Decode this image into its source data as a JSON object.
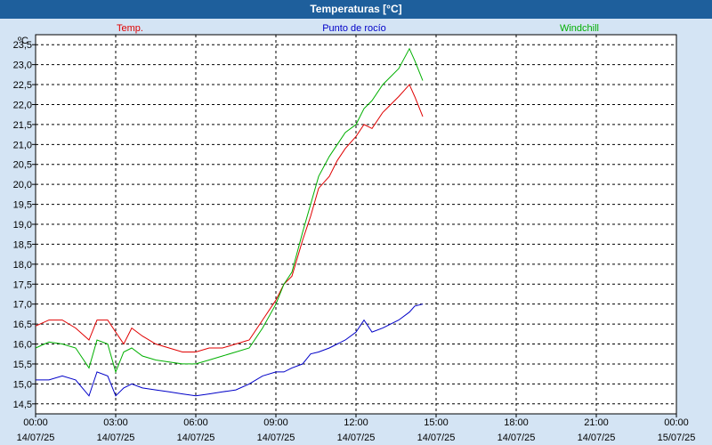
{
  "window": {
    "title": "Temperaturas [°C]"
  },
  "chart_data": {
    "type": "line",
    "title": "Temperaturas [°C]",
    "y_unit": "ºC",
    "ylim": [
      14.25,
      23.75
    ],
    "y_ticks": [
      "14,5",
      "15,0",
      "15,5",
      "16,0",
      "16,5",
      "17,0",
      "17,5",
      "18,0",
      "18,5",
      "19,0",
      "19,5",
      "20,0",
      "20,5",
      "21,0",
      "21,5",
      "22,0",
      "22,5",
      "23,0",
      "23,5"
    ],
    "y_tick_values": [
      14.5,
      15.0,
      15.5,
      16.0,
      16.5,
      17.0,
      17.5,
      18.0,
      18.5,
      19.0,
      19.5,
      20.0,
      20.5,
      21.0,
      21.5,
      22.0,
      22.5,
      23.0,
      23.5
    ],
    "xlim": [
      0,
      24
    ],
    "x_ticks": [
      {
        "time": "00:00",
        "date": "14/07/25"
      },
      {
        "time": "03:00",
        "date": "14/07/25"
      },
      {
        "time": "06:00",
        "date": "14/07/25"
      },
      {
        "time": "09:00",
        "date": "14/07/25"
      },
      {
        "time": "12:00",
        "date": "14/07/25"
      },
      {
        "time": "15:00",
        "date": "14/07/25"
      },
      {
        "time": "18:00",
        "date": "14/07/25"
      },
      {
        "time": "21:00",
        "date": "14/07/25"
      },
      {
        "time": "00:00",
        "date": "15/07/25"
      }
    ],
    "x_tick_hours": [
      0,
      3,
      6,
      9,
      12,
      15,
      18,
      21,
      24
    ],
    "grid": true,
    "legend": "top",
    "series": [
      {
        "name": "Temp.",
        "color": "#e00000",
        "x": [
          0,
          0.5,
          1,
          1.5,
          2,
          2.3,
          2.7,
          3,
          3.3,
          3.6,
          4,
          4.5,
          5,
          5.5,
          6,
          6.5,
          7,
          7.5,
          8,
          8.5,
          9,
          9.3,
          9.6,
          10,
          10.3,
          10.6,
          11,
          11.3,
          11.6,
          12,
          12.3,
          12.6,
          13,
          13.3,
          13.6,
          14,
          14.2,
          14.5
        ],
        "y": [
          16.45,
          16.6,
          16.6,
          16.4,
          16.1,
          16.6,
          16.6,
          16.3,
          16.0,
          16.4,
          16.2,
          16.0,
          15.9,
          15.8,
          15.8,
          15.9,
          15.9,
          16.0,
          16.1,
          16.6,
          17.1,
          17.5,
          17.7,
          18.6,
          19.2,
          19.9,
          20.2,
          20.6,
          20.9,
          21.2,
          21.5,
          21.4,
          21.8,
          22.0,
          22.2,
          22.5,
          22.2,
          21.7
        ]
      },
      {
        "name": "Punto de rocío",
        "color": "#0000c8",
        "x": [
          0,
          0.5,
          1,
          1.5,
          2,
          2.3,
          2.7,
          3,
          3.3,
          3.6,
          4,
          4.5,
          5,
          5.5,
          6,
          6.5,
          7,
          7.5,
          8,
          8.5,
          9,
          9.3,
          9.6,
          10,
          10.3,
          10.6,
          11,
          11.3,
          11.6,
          12,
          12.3,
          12.6,
          13,
          13.3,
          13.6,
          14,
          14.2,
          14.5
        ],
        "y": [
          15.1,
          15.1,
          15.2,
          15.1,
          14.7,
          15.3,
          15.2,
          14.7,
          14.9,
          15.0,
          14.9,
          14.85,
          14.8,
          14.75,
          14.7,
          14.75,
          14.8,
          14.85,
          15.0,
          15.2,
          15.3,
          15.3,
          15.4,
          15.5,
          15.75,
          15.8,
          15.9,
          16.0,
          16.1,
          16.3,
          16.6,
          16.3,
          16.4,
          16.5,
          16.6,
          16.8,
          16.95,
          17.0
        ]
      },
      {
        "name": "Windchill",
        "color": "#00b000",
        "x": [
          0,
          0.5,
          1,
          1.5,
          2,
          2.3,
          2.7,
          3,
          3.3,
          3.6,
          4,
          4.5,
          5,
          5.5,
          6,
          6.5,
          7,
          7.5,
          8,
          8.5,
          9,
          9.3,
          9.6,
          10,
          10.3,
          10.6,
          11,
          11.3,
          11.6,
          12,
          12.3,
          12.6,
          13,
          13.3,
          13.6,
          14,
          14.2,
          14.5
        ],
        "y": [
          15.9,
          16.05,
          16.0,
          15.9,
          15.4,
          16.1,
          16.0,
          15.3,
          15.8,
          15.9,
          15.7,
          15.6,
          15.55,
          15.5,
          15.5,
          15.6,
          15.7,
          15.8,
          15.9,
          16.4,
          17.0,
          17.5,
          17.8,
          18.8,
          19.5,
          20.2,
          20.7,
          21.0,
          21.3,
          21.5,
          21.9,
          22.1,
          22.5,
          22.7,
          22.9,
          23.4,
          23.1,
          22.6
        ]
      }
    ]
  }
}
